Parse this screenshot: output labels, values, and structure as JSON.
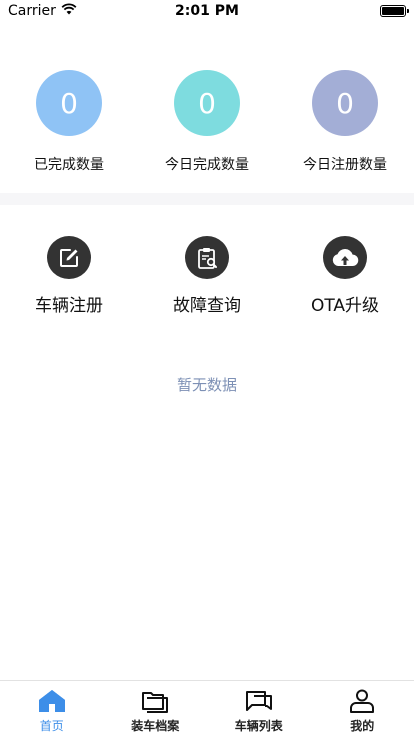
{
  "status_bar": {
    "carrier": "Carrier",
    "time": "2:01 PM"
  },
  "stats": [
    {
      "value": "0",
      "label": "已完成数量",
      "color": "#8fc3f5"
    },
    {
      "value": "0",
      "label": "今日完成数量",
      "color": "#7edcdf"
    },
    {
      "value": "0",
      "label": "今日注册数量",
      "color": "#a3aed6"
    }
  ],
  "features": [
    {
      "label": "车辆注册",
      "icon": "edit-icon"
    },
    {
      "label": "故障查询",
      "icon": "clipboard-search-icon"
    },
    {
      "label": "OTA升级",
      "icon": "cloud-upload-icon"
    }
  ],
  "empty_state": {
    "text": "暂无数据"
  },
  "tab_bar": {
    "items": [
      {
        "label": "首页",
        "icon": "home-icon",
        "active": true
      },
      {
        "label": "装车档案",
        "icon": "folder-icon",
        "active": false
      },
      {
        "label": "车辆列表",
        "icon": "chat-list-icon",
        "active": false
      },
      {
        "label": "我的",
        "icon": "user-icon",
        "active": false
      }
    ],
    "active_color": "#3d8ee8"
  }
}
